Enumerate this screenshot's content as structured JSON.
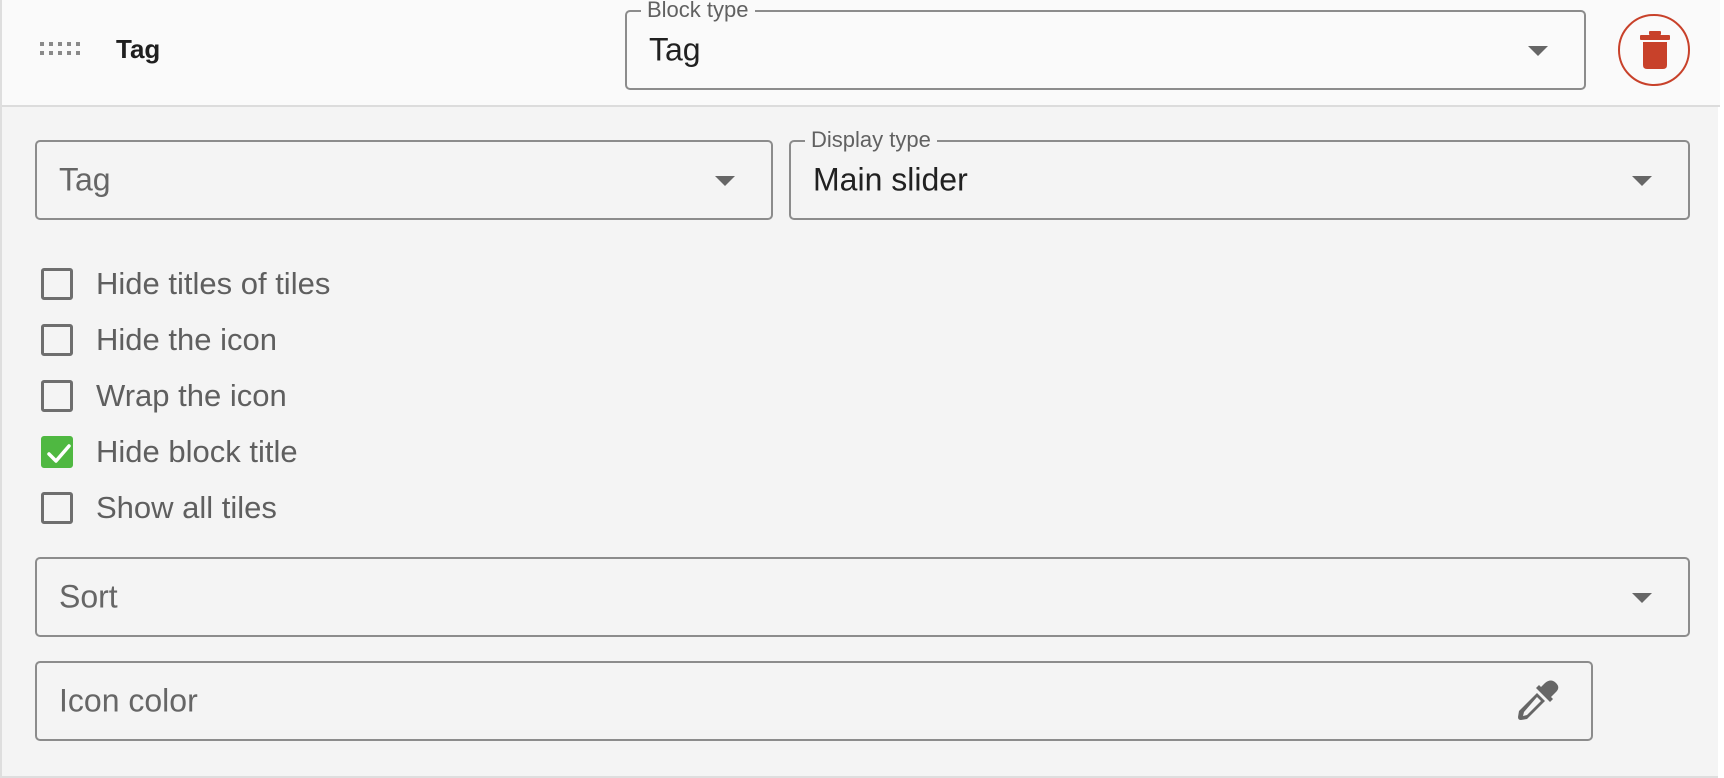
{
  "header": {
    "block_name": "Tag",
    "block_type": {
      "label": "Block type",
      "value": "Tag"
    }
  },
  "fields": {
    "tag_select": {
      "value": "Tag"
    },
    "display_type": {
      "label": "Display type",
      "value": "Main slider"
    },
    "sort": {
      "value": "Sort"
    },
    "icon_color": {
      "value": "Icon color"
    }
  },
  "options": [
    {
      "label": "Hide titles of tiles",
      "checked": false
    },
    {
      "label": "Hide the icon",
      "checked": false
    },
    {
      "label": "Wrap the icon",
      "checked": false
    },
    {
      "label": "Hide block title",
      "checked": true
    },
    {
      "label": "Show all tiles",
      "checked": false
    }
  ],
  "colors": {
    "check_accent": "#4fb841",
    "delete_accent": "#c8412a"
  },
  "icons": {
    "drag": "drag-handle-icon",
    "delete": "trash-icon",
    "picker": "eyedropper-icon",
    "caret": "chevron-down-icon",
    "check": "checkmark-icon"
  }
}
